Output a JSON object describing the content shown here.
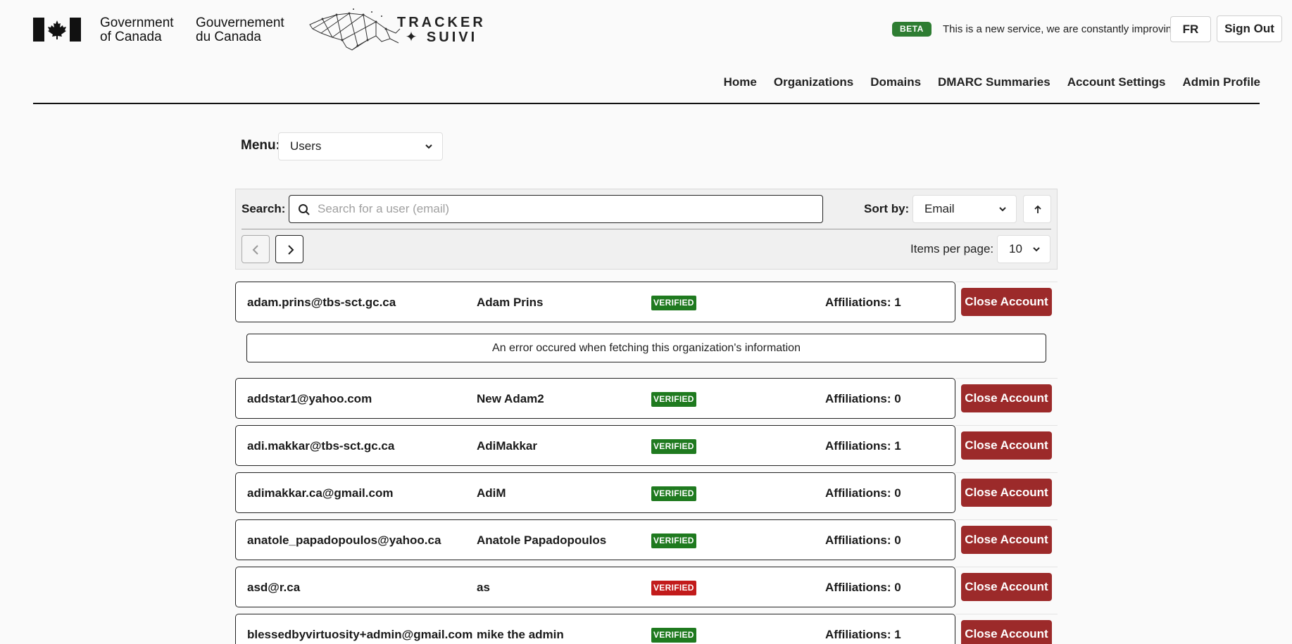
{
  "header": {
    "government_en": [
      "Government",
      "of Canada"
    ],
    "government_fr": [
      "Gouvernement",
      "du Canada"
    ],
    "tracker_logo": [
      "TRACKER",
      "✦ SUIVI"
    ],
    "beta_badge": "BETA",
    "beta_text": "This is a new service, we are constantly improving.",
    "lang_button": "FR",
    "signout_button": "Sign Out"
  },
  "nav": {
    "items": [
      "Home",
      "Organizations",
      "Domains",
      "DMARC Summaries",
      "Account Settings",
      "Admin Profile"
    ]
  },
  "menu": {
    "label": "Menu:",
    "selected": "Users"
  },
  "search": {
    "label": "Search:",
    "placeholder": "Search for a user (email)",
    "sort_label": "Sort by:",
    "sort_selected": "Email",
    "items_per_page_label": "Items per page:",
    "items_per_page": "10"
  },
  "error_message": "An error occured when fetching this organization's information",
  "close_label": "Close Account",
  "users": [
    {
      "email": "adam.prins@tbs-sct.gc.ca",
      "name": "Adam Prins",
      "status": "VERIFIED",
      "status_color": "#1f7a1f",
      "affiliations": "Affiliations: 1"
    },
    {
      "email": "addstar1@yahoo.com",
      "name": "New Adam2",
      "status": "VERIFIED",
      "status_color": "#1f7a1f",
      "affiliations": "Affiliations: 0"
    },
    {
      "email": "adi.makkar@tbs-sct.gc.ca",
      "name": "AdiMakkar",
      "status": "VERIFIED",
      "status_color": "#1f7a1f",
      "affiliations": "Affiliations: 1"
    },
    {
      "email": "adimakkar.ca@gmail.com",
      "name": "AdiM",
      "status": "VERIFIED",
      "status_color": "#1f7a1f",
      "affiliations": "Affiliations: 0"
    },
    {
      "email": "anatole_papadopoulos@yahoo.ca",
      "name": "Anatole Papadopoulos",
      "status": "VERIFIED",
      "status_color": "#1f7a1f",
      "affiliations": "Affiliations: 0"
    },
    {
      "email": "asd@r.ca",
      "name": "as",
      "status": "VERIFIED",
      "status_color": "#c21b1b",
      "affiliations": "Affiliations: 0"
    },
    {
      "email": "blessedbyvirtuosity+admin@gmail.com",
      "name": "mike the admin",
      "status": "VERIFIED",
      "status_color": "#1f7a1f",
      "affiliations": "Affiliations: 1"
    }
  ],
  "colors": {
    "verified": "#1f7a1f",
    "unverified": "#c21b1b",
    "close_button": "#9c2a2a",
    "beta": "#2e7d32"
  }
}
